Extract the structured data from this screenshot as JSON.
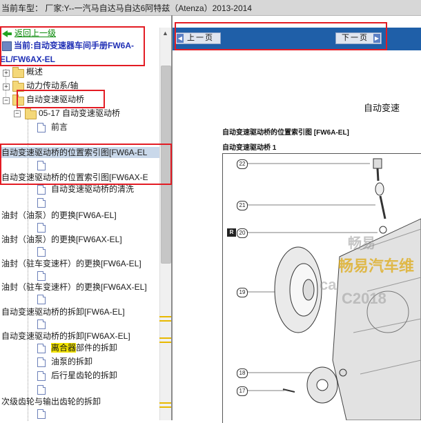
{
  "header": {
    "title": "当前车型：  厂家:Y--一汽马自达马自达6阿特兹（Atenza）2013-2014"
  },
  "tree": {
    "back_label": "返回上一级",
    "current_line1": "当前:自动变速器车间手册FW6A-",
    "current_line2": "EL/FW6AX-EL",
    "items": [
      {
        "label": "概述"
      },
      {
        "label": "动力传动系/轴"
      },
      {
        "label": "自动变速驱动桥"
      },
      {
        "label": "05-17 自动变速驱动桥"
      },
      {
        "label": "前言"
      },
      {
        "label": "自动变速驱动桥的位置索引图[FW6A-EL"
      },
      {
        "label": "自动变速驱动桥的位置索引图[FW6AX-E"
      },
      {
        "label": "自动变速驱动桥的清洗"
      },
      {
        "label": "油封（油泵）的更换[FW6A-EL]"
      },
      {
        "label": "油封（油泵）的更换[FW6AX-EL]"
      },
      {
        "label": "油封（驻车变速杆）的更换[FW6A-EL]"
      },
      {
        "label": "油封（驻车变速杆）的更换[FW6AX-EL]"
      },
      {
        "label": "自动变速驱动桥的拆卸[FW6A-EL]"
      },
      {
        "label": "自动变速驱动桥的拆卸[FW6AX-EL]"
      },
      {
        "label_hl": "离合器",
        "label_rest": "部件的拆卸"
      },
      {
        "label": "油泵的拆卸"
      },
      {
        "label": "后行星齿轮的拆卸"
      },
      {
        "label": "次级齿轮与输出齿轮的拆卸"
      }
    ]
  },
  "toolbar": {
    "prev_label": "上一页",
    "next_label": "下一页"
  },
  "document": {
    "title": "自动变速",
    "subtitle": "自动变速驱动桥的位置索引图 [FW6A-EL]",
    "section": "自动变速驱动桥 1",
    "callouts": [
      "22",
      "21",
      "20",
      "19",
      "18",
      "17"
    ],
    "r_tag": "R",
    "watermark_1": "畅易",
    "watermark_2": "畅易汽车维",
    "watermark_3": "ca",
    "watermark_4": "C2018"
  },
  "colors": {
    "accent": "#1f5fa8",
    "highlight_box": "#e31b23",
    "search_hit": "#f2e300"
  }
}
